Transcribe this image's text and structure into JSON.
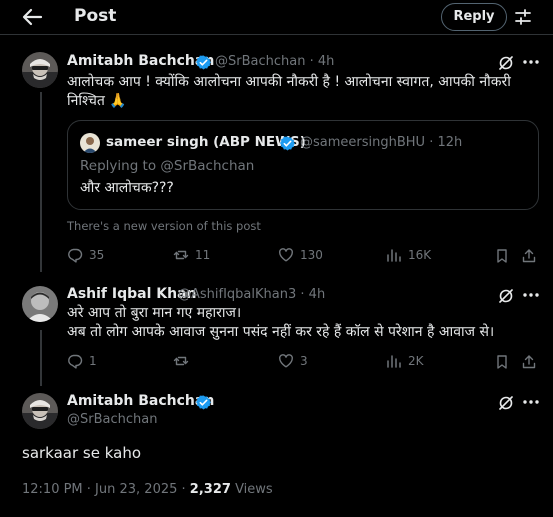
{
  "header": {
    "title": "Post",
    "reply_label": "Reply"
  },
  "main_post": {
    "author_name": "Amitabh Bachchan",
    "handle": "@SrBachchan",
    "time": "· 4h",
    "text_line1": "आलोचक आप ! क्योंकि आलोचना आपकी नौकरी है ! आलोचना स्वागत, आपकी नौकरी",
    "text_line2": "निश्चित 🙏",
    "quoted": {
      "author_name": "sameer singh (ABP NEWS)",
      "handle": "@sameersinghBHU",
      "time": "· 12h",
      "replying_to_prefix": "Replying to ",
      "replying_to_handle": "@SrBachchan",
      "text": "और आलोचक???"
    },
    "new_version_notice": "There's a new version of this post",
    "stats": {
      "replies": "35",
      "reposts": "11",
      "likes": "130",
      "views": "16K"
    }
  },
  "reply": {
    "author_name": "Ashif Iqbal Khan",
    "handle": "@AshifIqbalKhan3",
    "time": "· 4h",
    "text_line1": "अरे आप तो बुरा मान गए महाराज।",
    "text_line2": "अब तो लोग आपके आवाज सुनना पसंद नहीं कर रहे हैं कॉल से परेशान है आवाज से।",
    "stats": {
      "replies": "1",
      "reposts": "",
      "likes": "3",
      "views": "2K"
    }
  },
  "focused_post": {
    "author_name": "Amitabh Bachchan",
    "handle": "@SrBachchan",
    "text": "sarkaar se kaho",
    "timestamp": "12:10 PM · Jun 23, 2025 ·",
    "views_count": "2,327",
    "views_label": "Views"
  },
  "colors": {
    "background": "#000000",
    "text": "#e7e9ea",
    "muted": "#71767b",
    "verified": "#1d9bf0",
    "border": "#2f3336"
  }
}
